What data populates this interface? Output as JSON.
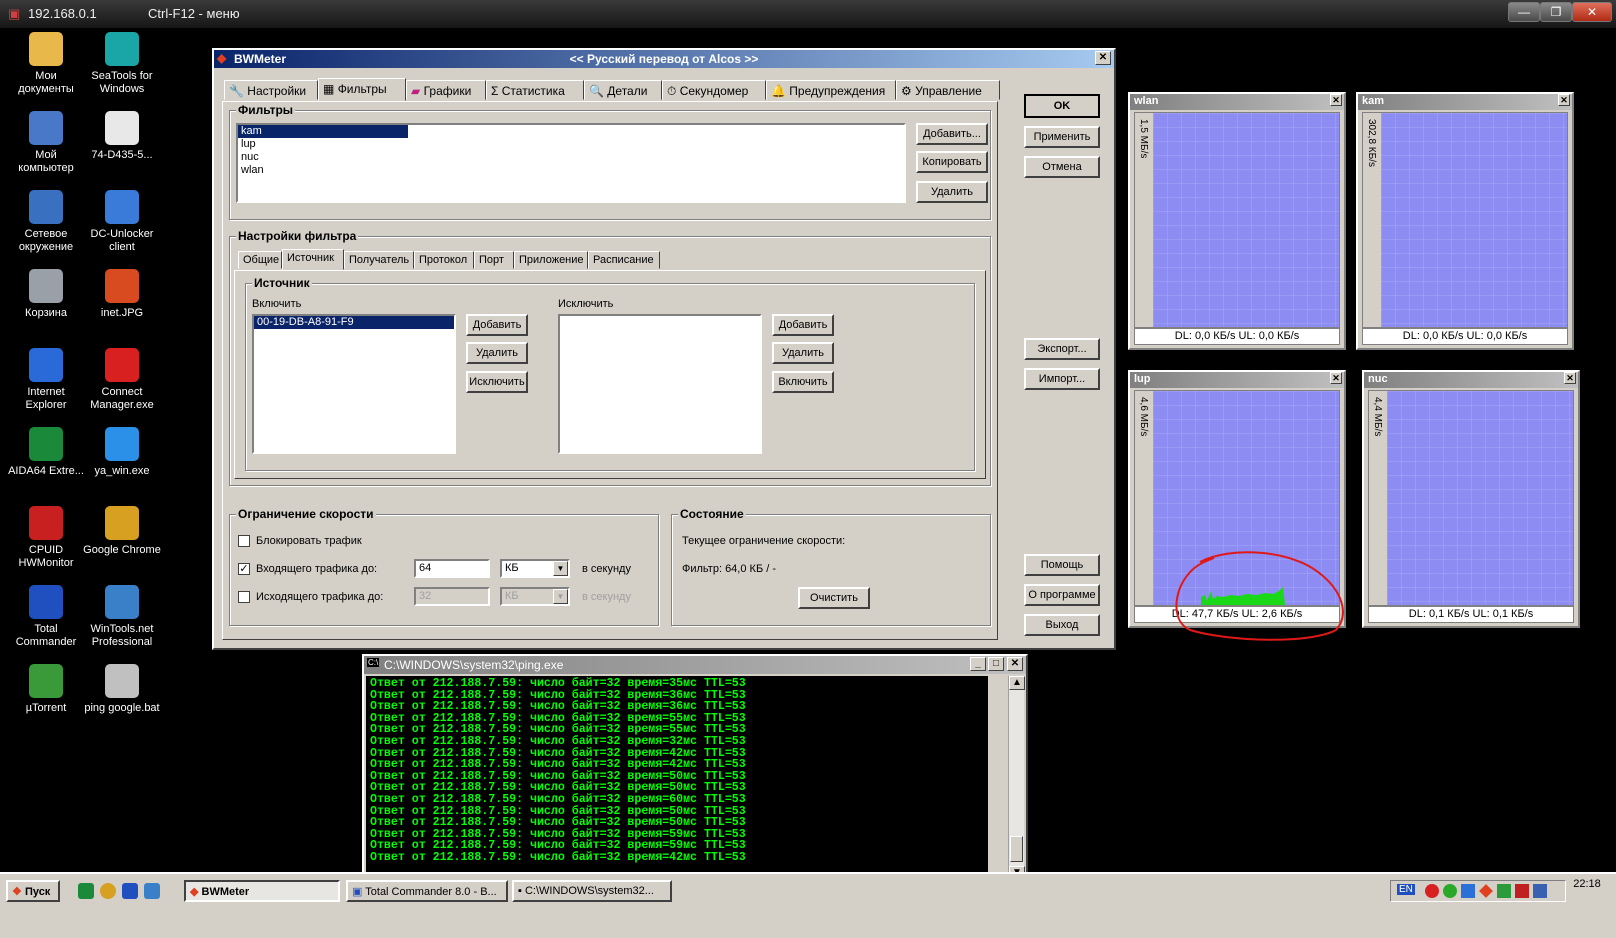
{
  "rdp": {
    "host": "192.168.0.1",
    "hint": "Ctrl-F12 - меню"
  },
  "desktop_icons": [
    {
      "label": "Мои документы",
      "icon": "folder-icon",
      "color": "#e8b84a"
    },
    {
      "label": "SeaTools for Windows",
      "icon": "seatools-icon",
      "color": "#1aa6a6"
    },
    {
      "label": "Мой компьютер",
      "icon": "computer-icon",
      "color": "#4a78c8"
    },
    {
      "label": "74-D435-5...",
      "icon": "file-icon",
      "color": "#e8e8e8"
    },
    {
      "label": "Сетевое окружение",
      "icon": "network-icon",
      "color": "#3a70c0"
    },
    {
      "label": "DC-Unlocker client",
      "icon": "dc-unlocker-icon",
      "color": "#3a7ad8"
    },
    {
      "label": "Корзина",
      "icon": "recycle-bin-icon",
      "color": "#9aa0a8"
    },
    {
      "label": "inet.JPG",
      "icon": "image-file-icon",
      "color": "#d84a20"
    },
    {
      "label": "Internet Explorer",
      "icon": "internet-explorer-icon",
      "color": "#2a6ad8"
    },
    {
      "label": "Connect Manager.exe",
      "icon": "connect-manager-icon",
      "color": "#d82020"
    },
    {
      "label": "AIDA64 Extre...",
      "icon": "aida64-icon",
      "color": "#1a8a3a"
    },
    {
      "label": "ya_win.exe",
      "icon": "ya-win-icon",
      "color": "#2a90e8"
    },
    {
      "label": "CPUID HWMonitor",
      "icon": "hwmonitor-icon",
      "color": "#c82020"
    },
    {
      "label": "Google Chrome",
      "icon": "chrome-icon",
      "color": "#d8a020"
    },
    {
      "label": "Total Commander",
      "icon": "total-commander-icon",
      "color": "#2050c0"
    },
    {
      "label": "WinTools.net Professional",
      "icon": "wintools-icon",
      "color": "#3a80c8"
    },
    {
      "label": "µTorrent",
      "icon": "utorrent-icon",
      "color": "#3a9a3a"
    },
    {
      "label": "ping google.bat",
      "icon": "batch-file-icon",
      "color": "#c0c0c0"
    }
  ],
  "bwmeter": {
    "title": "BWMeter",
    "subtitle": "<< Русский перевод от Alcos >>",
    "tabs": [
      "Настройки",
      "Фильтры",
      "Графики",
      "Статистика",
      "Детали",
      "Секундомер",
      "Предупреждения",
      "Управление"
    ],
    "filters_group": "Фильтры",
    "filters": [
      "kam",
      "lup",
      "nuc",
      "wlan"
    ],
    "filter_buttons": {
      "add": "Добавить...",
      "copy": "Копировать",
      "delete": "Удалить"
    },
    "filter_settings_group": "Настройки фильтра",
    "subtabs": [
      "Общие",
      "Источник",
      "Получатель",
      "Протокол",
      "Порт",
      "Приложение",
      "Расписание"
    ],
    "source_group": "Источник",
    "include_label": "Включить",
    "include_items": [
      "00-19-DB-A8-91-F9"
    ],
    "include_buttons": {
      "add": "Добавить",
      "delete": "Удалить",
      "exclude": "Исключить"
    },
    "exclude_label": "Исключить",
    "exclude_buttons": {
      "add": "Добавить",
      "delete": "Удалить",
      "include": "Включить"
    },
    "speed_group": "Ограничение скорости",
    "block_traffic": "Блокировать трафик",
    "incoming_label": "Входящего трафика до:",
    "incoming_value": "64",
    "incoming_unit": "КБ",
    "outgoing_label": "Исходящего трафика до:",
    "outgoing_value": "32",
    "outgoing_unit": "КБ",
    "per_second": "в секунду",
    "state_group": "Состояние",
    "current_limit": "Текущее ограничение скорости:",
    "filter_state": "Фильтр: 64,0 КБ / -",
    "clear": "Очистить",
    "side_buttons": {
      "ok": "OK",
      "apply": "Применить",
      "cancel": "Отмена",
      "export": "Экспорт...",
      "import": "Импорт...",
      "help": "Помощь",
      "about": "О программе",
      "exit": "Выход"
    }
  },
  "graphs": [
    {
      "name": "wlan",
      "scale": "1,5 МБ/s",
      "status": "DL: 0,0 КБ/s  UL: 0,0 КБ/s"
    },
    {
      "name": "kam",
      "scale": "302,8 КБ/s",
      "status": "DL: 0,0 КБ/s  UL: 0,0 КБ/s"
    },
    {
      "name": "lup",
      "scale": "4,6 МБ/s",
      "status": "DL: 47,7 КБ/s  UL: 2,6 КБ/s"
    },
    {
      "name": "nuc",
      "scale": "4,4 МБ/s",
      "status": "DL: 0,1 КБ/s  UL: 0,1 КБ/s"
    }
  ],
  "console": {
    "title": "C:\\WINDOWS\\system32\\ping.exe",
    "lines": [
      "Ответ от 212.188.7.59: число байт=32 время=35мс TTL=53",
      "Ответ от 212.188.7.59: число байт=32 время=36мс TTL=53",
      "Ответ от 212.188.7.59: число байт=32 время=36мс TTL=53",
      "Ответ от 212.188.7.59: число байт=32 время=55мс TTL=53",
      "Ответ от 212.188.7.59: число байт=32 время=55мс TTL=53",
      "Ответ от 212.188.7.59: число байт=32 время=32мс TTL=53",
      "Ответ от 212.188.7.59: число байт=32 время=42мс TTL=53",
      "Ответ от 212.188.7.59: число байт=32 время=42мс TTL=53",
      "Ответ от 212.188.7.59: число байт=32 время=50мс TTL=53",
      "Ответ от 212.188.7.59: число байт=32 время=50мс TTL=53",
      "Ответ от 212.188.7.59: число байт=32 время=60мс TTL=53",
      "Ответ от 212.188.7.59: число байт=32 время=50мс TTL=53",
      "Ответ от 212.188.7.59: число байт=32 время=50мс TTL=53",
      "Ответ от 212.188.7.59: число байт=32 время=59мс TTL=53",
      "Ответ от 212.188.7.59: число байт=32 время=59мс TTL=53",
      "Ответ от 212.188.7.59: число байт=32 время=42мс TTL=53"
    ]
  },
  "taskbar": {
    "start": "Пуск",
    "tasks": [
      "BWMeter",
      "Total Commander 8.0 - В...",
      "C:\\WINDOWS\\system32..."
    ],
    "lang": "EN",
    "clock": "22:18"
  }
}
